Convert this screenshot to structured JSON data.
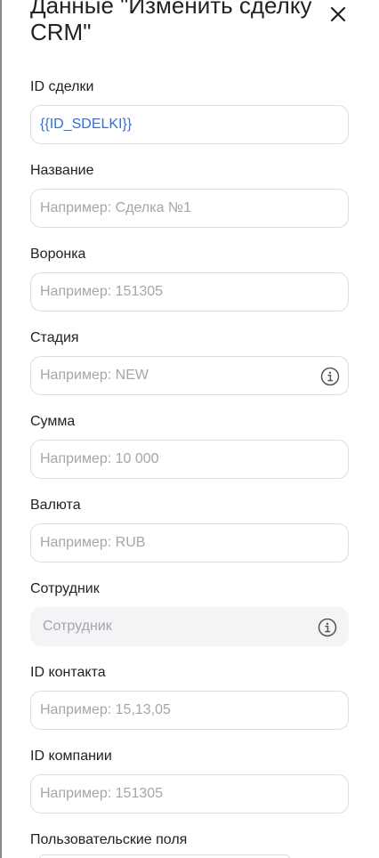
{
  "dialog": {
    "title": "Данные \"Изменить сделку CRM\""
  },
  "fields": [
    {
      "label": "ID сделки",
      "value": "{{ID_SDELKI}}",
      "placeholder": "",
      "info_icon": false,
      "disabled": false
    },
    {
      "label": "Название",
      "value": "",
      "placeholder": "Например: Сделка №1",
      "info_icon": false,
      "disabled": false
    },
    {
      "label": "Воронка",
      "value": "",
      "placeholder": "Например: 151305",
      "info_icon": false,
      "disabled": false
    },
    {
      "label": "Стадия",
      "value": "",
      "placeholder": "Например: NEW",
      "info_icon": true,
      "disabled": false
    },
    {
      "label": "Сумма",
      "value": "",
      "placeholder": "Например: 10 000",
      "info_icon": false,
      "disabled": false
    },
    {
      "label": "Валюта",
      "value": "",
      "placeholder": "Например: RUB",
      "info_icon": false,
      "disabled": false
    },
    {
      "label": "Сотрудник",
      "value": "",
      "placeholder": "Сотрудник",
      "info_icon": true,
      "disabled": true
    },
    {
      "label": "ID контакта",
      "value": "",
      "placeholder": "Например: 15,13,05",
      "info_icon": false,
      "disabled": false
    },
    {
      "label": "ID компании",
      "value": "",
      "placeholder": "Например: 151305",
      "info_icon": false,
      "disabled": false
    }
  ],
  "custom_fields": {
    "label": "Пользовательские поля"
  },
  "icons": {
    "close": "close-icon",
    "info": "info-icon"
  },
  "colors": {
    "value_text": "#2f6fd6",
    "placeholder_text": "#a3a6ad",
    "input_border": "#dcdee3",
    "disabled_bg": "#f3f4f6"
  }
}
